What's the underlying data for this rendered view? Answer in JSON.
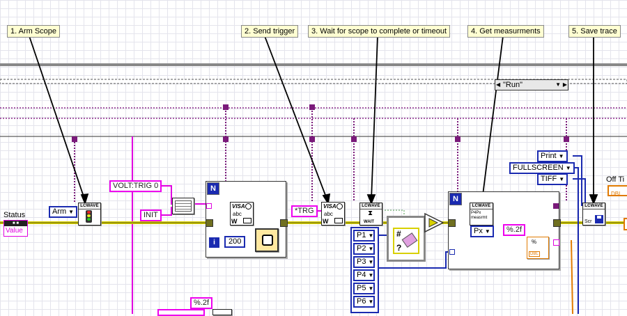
{
  "notes": {
    "arm": "1. Arm Scope",
    "trigger": "2. Send trigger",
    "wait": "3. Wait for scope to complete or timeout",
    "meas": "4. Get measurments",
    "save": "5. Save trace"
  },
  "status": {
    "label": "Status",
    "value_tag": "Value"
  },
  "case_selector": "\"Run\"",
  "off_label": "Off Ti",
  "dbl_tag": "DBL",
  "constants": {
    "volt_trig": "VOLT:TRIG 0",
    "init": "INIT",
    "trg": "*TRG",
    "fmt1": "%.2f",
    "fmt2": "%.2f",
    "wait_ms": "200"
  },
  "enums": {
    "arm": "Arm",
    "px": "Px",
    "print": "Print",
    "fullscreen": "FULLSCREEN",
    "tiff": "TIFF",
    "params": [
      "P1",
      "P2",
      "P3",
      "P4",
      "P5",
      "P6"
    ]
  },
  "vi_labels": {
    "lowave": "LCWAVE",
    "visa": "VISA",
    "abc": "abc",
    "wait": "WAIT",
    "meas_text": "P4Px measrmt",
    "scr": "Scr",
    "w": "W"
  },
  "loop_labels": {
    "n": "N",
    "i": "i"
  },
  "colors": {
    "string_wire": "#e000e0",
    "error_wire": "#d8d000",
    "ref_wire": "#1a2ab0",
    "dbl_wire": "#e07a00",
    "case_wire": "#7a1a7a"
  }
}
